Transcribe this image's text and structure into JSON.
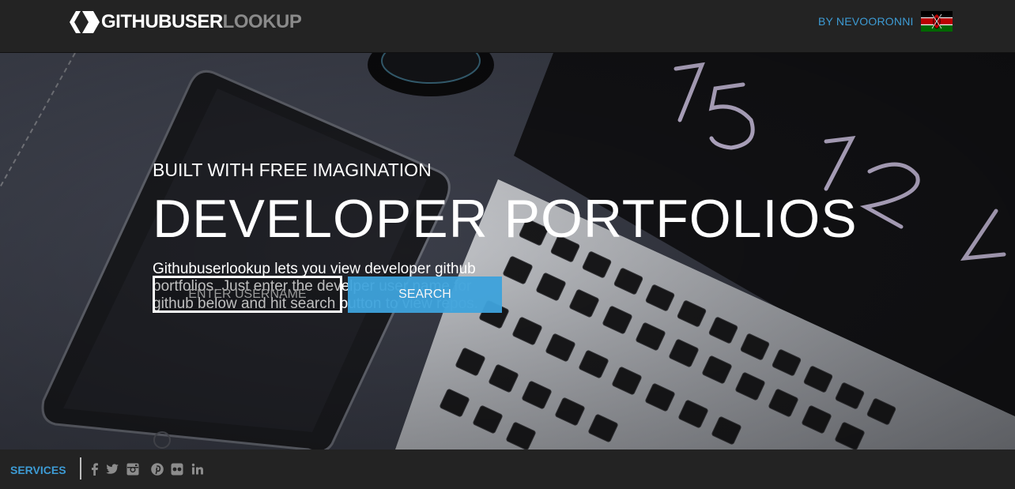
{
  "header": {
    "brand_primary": "GITHUBUSER",
    "brand_secondary": "LOOKUP",
    "byline": "BY NEVOORONNI",
    "flag_icon": "kenya-flag-icon"
  },
  "hero": {
    "kicker": "BUILT WITH FREE IMAGINATION",
    "headline": "DEVELOPER PORTFOLIOS",
    "description": "Githubuserlookup lets you view developer github portfolios. Just enter the develper user name for github below and hit search button to view repos.",
    "search": {
      "placeholder": "ENTER USERNAME",
      "value": "",
      "button_label": "SEARCH"
    }
  },
  "footer": {
    "services_label": "SERVICES",
    "social_icons": [
      "facebook-icon",
      "twitter-icon",
      "instagram-icon",
      "pinterest-icon",
      "flickr-icon",
      "linkedin-icon"
    ]
  },
  "colors": {
    "accent": "#3d9bd4",
    "button": "#3ea3dc",
    "bar": "#232323"
  }
}
